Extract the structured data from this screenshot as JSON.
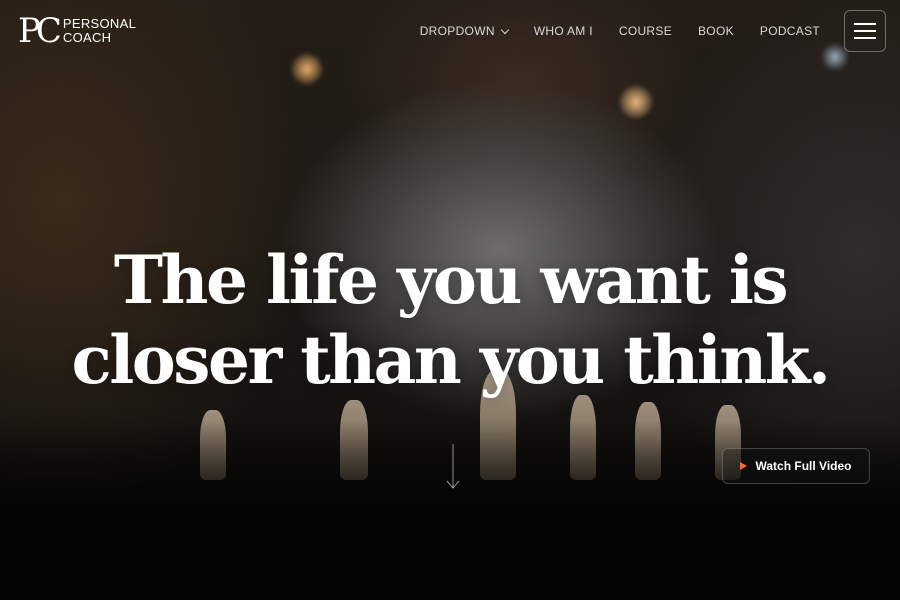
{
  "brand": {
    "mark": "PC",
    "line1": "PERSONAL",
    "line2": "COACH"
  },
  "nav": {
    "items": [
      {
        "label": "DROPDOWN",
        "has_dropdown": true
      },
      {
        "label": "WHO AM I",
        "has_dropdown": false
      },
      {
        "label": "COURSE",
        "has_dropdown": false
      },
      {
        "label": "BOOK",
        "has_dropdown": false
      },
      {
        "label": "PODCAST",
        "has_dropdown": false
      }
    ],
    "menu_icon": "hamburger-icon"
  },
  "hero": {
    "headline_line1": "The life you want is",
    "headline_line2": "closer than you think.",
    "scroll_icon": "arrow-down-icon",
    "watch_label": "Watch Full Video",
    "watch_icon": "play-icon",
    "accent_color": "#f06b3c"
  }
}
